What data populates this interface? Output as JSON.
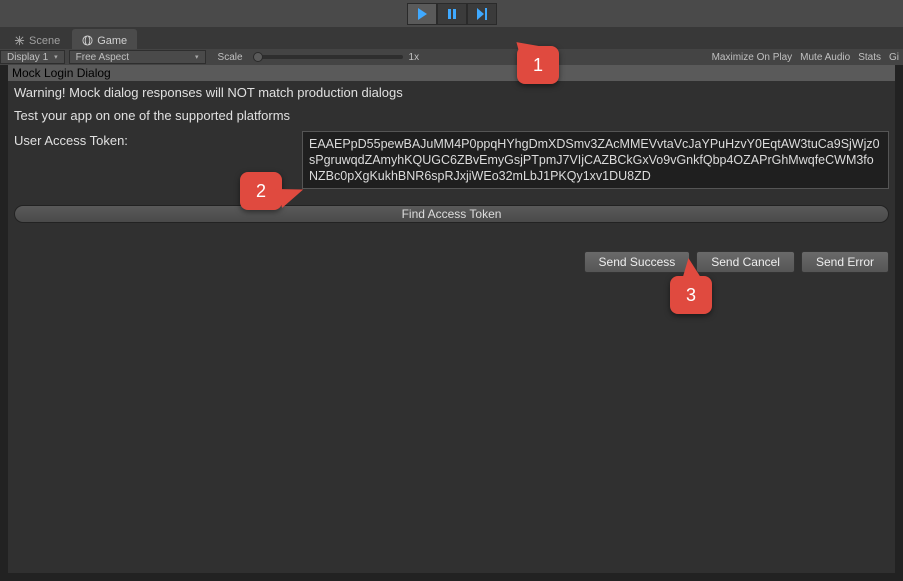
{
  "playbar": {
    "playing": true
  },
  "tabs": {
    "scene": "Scene",
    "game": "Game"
  },
  "controls": {
    "display_dropdown": "Display 1",
    "aspect_dropdown": "Free Aspect",
    "scale_label": "Scale",
    "scale_value": "1x",
    "right": {
      "maximize": "Maximize On Play",
      "mute": "Mute Audio",
      "stats": "Stats",
      "gizmos": "Gi"
    }
  },
  "dialog": {
    "title": "Mock Login Dialog",
    "warning": "Warning! Mock dialog responses will NOT match production dialogs",
    "platform_hint": "Test your app on one of the supported platforms",
    "token_label": "User Access Token:",
    "token_value": "EAAEPpD55pewBAJuMM4P0ppqHYhgDmXDSmv3ZAcMMEVvtaVcJaYPuHzvY0EqtAW3tuCa9SjWjz0sPgruwqdZAmyhKQUGC6ZBvEmyGsjPTpmJ7VIjCAZBCkGxVo9vGnkfQbp4OZAPrGhMwqfeCWM3foNZBc0pXgKukhBNR6spRJxjiWEo32mLbJ1PKQy1xv1DU8ZD",
    "find_button": "Find Access Token",
    "send_success": "Send Success",
    "send_cancel": "Send Cancel",
    "send_error": "Send Error"
  },
  "annotations": {
    "c1": "1",
    "c2": "2",
    "c3": "3"
  }
}
